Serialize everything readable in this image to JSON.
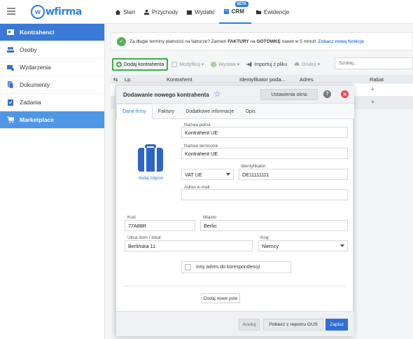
{
  "topnav": {
    "logo": "wfirma",
    "items": [
      {
        "label": "Start",
        "icon": "home-icon"
      },
      {
        "label": "Przychody",
        "icon": "income-icon"
      },
      {
        "label": "Wydatki",
        "icon": "wallet-icon"
      },
      {
        "label": "CRM",
        "icon": "crm-icon",
        "badge": "BETA",
        "active": true
      },
      {
        "label": "Ewidencje",
        "icon": "folder-icon"
      }
    ]
  },
  "sidebar": {
    "items": [
      {
        "label": "Kontrahenci",
        "icon": "contacts-card-icon",
        "active": true
      },
      {
        "label": "Osoby",
        "icon": "people-icon"
      },
      {
        "label": "Wydarzenia",
        "icon": "events-icon"
      },
      {
        "label": "Dokumenty",
        "icon": "documents-icon"
      },
      {
        "label": "Zadania",
        "icon": "tasks-icon"
      },
      {
        "label": "Marketplace",
        "icon": "cart-icon",
        "highlighted": true
      }
    ]
  },
  "banner": {
    "text_before": "Za długie terminy płatności na fakturze? Zamień",
    "bold1": "FAKTURY",
    "text_mid": "na",
    "bold2": "GOTÓWKĘ",
    "text_after": "nawet w 5 minut!",
    "link": "Zobacz nową funkcję"
  },
  "toolbar": {
    "add": "Dodaj kontrahenta",
    "modify": "Modyfikuj",
    "issue": "Wystaw",
    "import": "Importuj z pliku",
    "print": "Drukuj",
    "search_placeholder": "Szukaj..."
  },
  "grid": {
    "columns": [
      "Lp.",
      "Kontrahent",
      "Identyfikator poda...",
      "Adres",
      "Rabat"
    ],
    "rows": [
      {
        "suffix": "a"
      },
      {
        "suffix": "a"
      }
    ]
  },
  "dialog": {
    "title": "Dodawanie nowego kontrahenta",
    "settings": "Ustawienia okna",
    "tabs": [
      "Dane firmy",
      "Faktury",
      "Dodatkowe informacje",
      "Opis"
    ],
    "photo_link": "dodaj zdjęcie",
    "fields": {
      "full_name": {
        "label": "Nazwa pełna",
        "value": "Kontrahent UE"
      },
      "short_name": {
        "label": "Nazwa skrócona",
        "value": "Kontrahent UE"
      },
      "vat_type": {
        "value": "VAT UE"
      },
      "identifier": {
        "label": "Identyfikator",
        "value": "DE11111111"
      },
      "email": {
        "label": "Adres e-mail",
        "value": ""
      },
      "zip": {
        "label": "Kod",
        "value": "77A88R"
      },
      "city": {
        "label": "Miasto",
        "value": "Berlin"
      },
      "street": {
        "label": "Ulica dom / lokal",
        "value": "Berlińska 11"
      },
      "country": {
        "label": "Kraj",
        "value": "Niemcy"
      }
    },
    "other_address": "inny adres do korespondencji",
    "add_field": "Dodaj nowe pole",
    "buttons": {
      "cancel": "Anuluj",
      "gus": "Pobierz z rejestru GUS",
      "save": "Zapisz"
    }
  }
}
